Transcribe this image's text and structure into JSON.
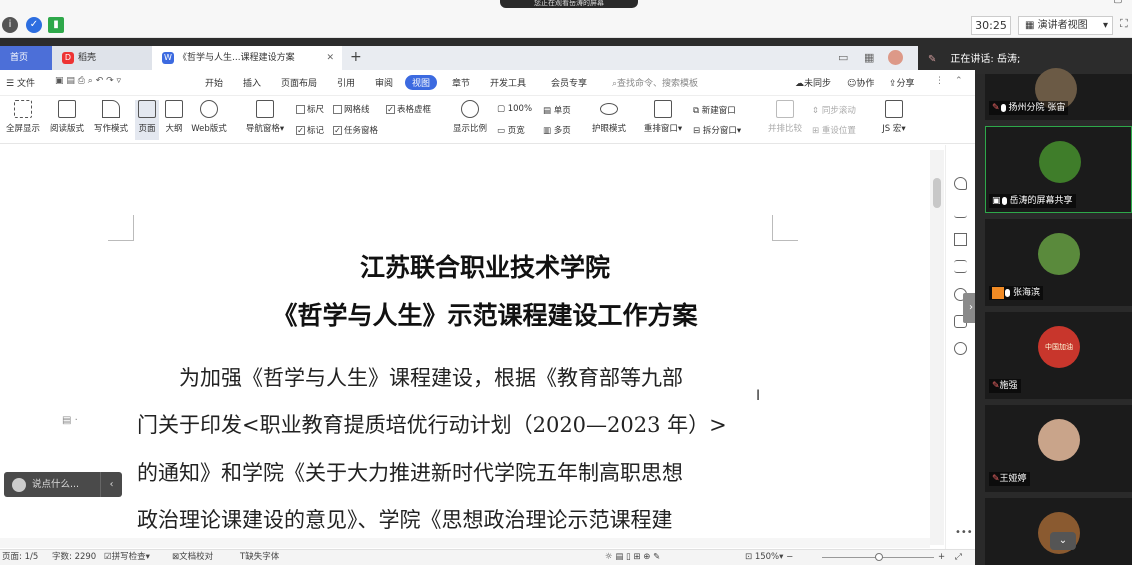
{
  "meeting": {
    "banner": "您正在观看岳涛的屏幕",
    "timer": "30:25",
    "view_mode": "演讲者视图",
    "speaking_label": "正在讲话: 岳涛;"
  },
  "tabs": [
    {
      "label": "首页"
    },
    {
      "label": "稻壳"
    },
    {
      "label": "《哲学与人生...课程建设方案"
    }
  ],
  "menu": {
    "file": "文件",
    "items": [
      "开始",
      "插入",
      "页面布局",
      "引用",
      "审阅",
      "视图",
      "章节",
      "开发工具",
      "会员专享"
    ],
    "search_placeholder": "查找命令、搜索模板",
    "sync": "未同步",
    "collab": "协作",
    "share": "分享"
  },
  "ribbon": {
    "fullscreen": "全屏显示",
    "reading": "阅读版式",
    "writing": "写作模式",
    "page": "页面",
    "outline": "大纲",
    "web": "Web版式",
    "nav_pane": "导航窗格",
    "ruler": "标尺",
    "gridlines": "网格线",
    "table_lines": "表格虚框",
    "markup": "标记",
    "task_pane": "任务窗格",
    "zoom_ratio": "显示比例",
    "zoom_100": "100%",
    "page_width": "页宽",
    "single_page": "单页",
    "multi_page": "多页",
    "eye_mode": "护眼模式",
    "rearrange": "重排窗口",
    "new_window": "新建窗口",
    "split_window": "拆分窗口",
    "side_by_side": "并排比较",
    "sync_scroll": "同步滚动",
    "reset_position": "重设位置",
    "js_macro": "JS 宏"
  },
  "document": {
    "title1": "江苏联合职业技术学院",
    "title2": "《哲学与人生》示范课程建设工作方案",
    "lines": [
      "　　为加强《哲学与人生》课程建设，根据《教育部等九部",
      "门关于印发<职业教育提质培优行动计划（2020—2023 年）>",
      "的通知》和学院《关于大力推进新时代学院五年制高职思想",
      "政治理论课建设的意见》、学院《思想政治理论示范课程建"
    ]
  },
  "comment": {
    "placeholder": "说点什么..."
  },
  "status": {
    "page": "页面: 1/5",
    "words": "字数: 2290",
    "spell": "拼写检查",
    "proof": "文档校对",
    "missing_font": "缺失字体",
    "zoom": "150%"
  },
  "participants": [
    {
      "name": "扬州分院 张宙"
    },
    {
      "name": "岳涛的屏幕共享"
    },
    {
      "name": "张海滨"
    },
    {
      "name": "施强"
    },
    {
      "name": "王娅婷"
    },
    {
      "name": ""
    }
  ],
  "avatar_badge_text": "中国加油",
  "colors": {
    "accent": "#3c6ae0",
    "active_border": "#2ea84a",
    "panel_bg": "#2a2a2a"
  }
}
